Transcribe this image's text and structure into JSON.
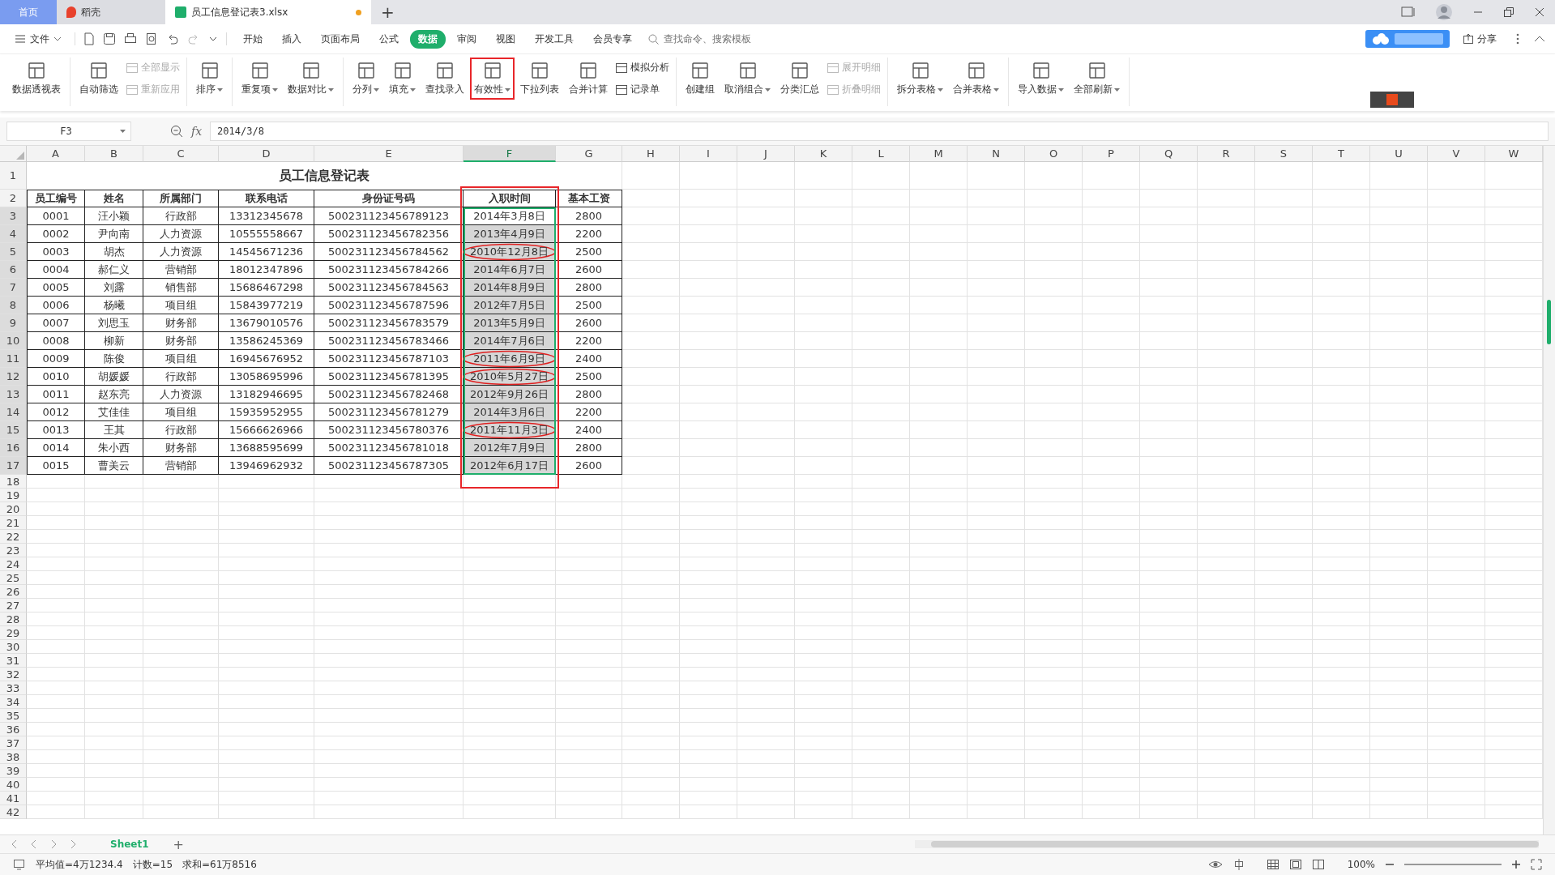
{
  "tabs": [
    {
      "kind": "home",
      "label": "首页",
      "selected": false
    },
    {
      "kind": "docer",
      "label": "稻壳",
      "selected": false
    },
    {
      "kind": "file",
      "label": "员工信息登记表3.xlsx",
      "selected": true,
      "unsaved": true
    }
  ],
  "new_tab": "+",
  "menu": {
    "file": "文件",
    "tabs": [
      {
        "label": "开始",
        "selected": false
      },
      {
        "label": "插入",
        "selected": false
      },
      {
        "label": "页面布局",
        "selected": false
      },
      {
        "label": "公式",
        "selected": false
      },
      {
        "label": "数据",
        "selected": true
      },
      {
        "label": "审阅",
        "selected": false
      },
      {
        "label": "视图",
        "selected": false
      },
      {
        "label": "开发工具",
        "selected": false
      },
      {
        "label": "会员专享",
        "selected": false
      }
    ],
    "search": {
      "placeholder": "查找命令、搜索模板"
    },
    "share": "分享"
  },
  "ribbon": [
    {
      "items": [
        {
          "kind": "large",
          "label": "数据透视表",
          "dropdown": false,
          "highlighted": false
        }
      ]
    },
    {
      "items": [
        {
          "kind": "large",
          "label": "自动筛选",
          "dropdown": false,
          "highlighted": false
        },
        {
          "kind": "stack",
          "items": [
            {
              "label": "全部显示",
              "disabled": true
            },
            {
              "label": "重新应用",
              "disabled": true
            }
          ]
        }
      ]
    },
    {
      "items": [
        {
          "kind": "large",
          "label": "排序",
          "dropdown": true,
          "highlighted": false
        }
      ]
    },
    {
      "items": [
        {
          "kind": "large",
          "label": "重复项",
          "dropdown": true,
          "highlighted": false
        },
        {
          "kind": "large",
          "label": "数据对比",
          "dropdown": true,
          "highlighted": false
        }
      ]
    },
    {
      "items": [
        {
          "kind": "large",
          "label": "分列",
          "dropdown": true,
          "highlighted": false
        },
        {
          "kind": "large",
          "label": "填充",
          "dropdown": true,
          "highlighted": false
        },
        {
          "kind": "large",
          "label": "查找录入",
          "dropdown": false,
          "highlighted": false
        },
        {
          "kind": "large",
          "label": "有效性",
          "dropdown": true,
          "highlighted": true
        },
        {
          "kind": "large",
          "label": "下拉列表",
          "dropdown": false,
          "highlighted": false
        },
        {
          "kind": "large",
          "label": "合并计算",
          "dropdown": false,
          "highlighted": false
        },
        {
          "kind": "stack",
          "items": [
            {
              "label": "模拟分析",
              "disabled": false
            },
            {
              "label": "记录单",
              "disabled": false
            }
          ]
        }
      ]
    },
    {
      "items": [
        {
          "kind": "large",
          "label": "创建组",
          "dropdown": false,
          "highlighted": false
        },
        {
          "kind": "large",
          "label": "取消组合",
          "dropdown": true,
          "highlighted": false
        },
        {
          "kind": "large",
          "label": "分类汇总",
          "dropdown": false,
          "highlighted": false
        },
        {
          "kind": "stack",
          "items": [
            {
              "label": "展开明细",
              "disabled": true
            },
            {
              "label": "折叠明细",
              "disabled": true
            }
          ]
        }
      ]
    },
    {
      "items": [
        {
          "kind": "large",
          "label": "拆分表格",
          "dropdown": true,
          "highlighted": false
        },
        {
          "kind": "large",
          "label": "合并表格",
          "dropdown": true,
          "highlighted": false
        }
      ]
    },
    {
      "items": [
        {
          "kind": "large",
          "label": "导入数据",
          "dropdown": true,
          "highlighted": false
        },
        {
          "kind": "large",
          "label": "全部刷新",
          "dropdown": true,
          "highlighted": false
        }
      ]
    }
  ],
  "formula_bar": {
    "name_box": "F3",
    "fx": "fx",
    "value": "2014/3/8"
  },
  "columns": [
    {
      "label": "A",
      "selected": false
    },
    {
      "label": "B",
      "selected": false
    },
    {
      "label": "C",
      "selected": false
    },
    {
      "label": "D",
      "selected": false
    },
    {
      "label": "E",
      "selected": false
    },
    {
      "label": "F",
      "selected": true
    },
    {
      "label": "G",
      "selected": false
    },
    {
      "label": "H",
      "selected": false
    },
    {
      "label": "I",
      "selected": false
    },
    {
      "label": "J",
      "selected": false
    },
    {
      "label": "K",
      "selected": false
    },
    {
      "label": "L",
      "selected": false
    },
    {
      "label": "M",
      "selected": false
    },
    {
      "label": "N",
      "selected": false
    },
    {
      "label": "O",
      "selected": false
    },
    {
      "label": "P",
      "selected": false
    },
    {
      "label": "Q",
      "selected": false
    },
    {
      "label": "R",
      "selected": false
    },
    {
      "label": "S",
      "selected": false
    },
    {
      "label": "T",
      "selected": false
    },
    {
      "label": "U",
      "selected": false
    },
    {
      "label": "V",
      "selected": false
    },
    {
      "label": "W",
      "selected": false
    }
  ],
  "title_row": {
    "row": "1",
    "text": "员工信息登记表"
  },
  "header_row": {
    "row": "2",
    "cells": [
      "员工编号",
      "姓名",
      "所属部门",
      "联系电话",
      "身份证号码",
      "入职时间",
      "基本工资"
    ]
  },
  "rows": [
    {
      "row": "3",
      "cells": [
        "0001",
        "汪小颖",
        "行政部",
        "13312345678",
        "500231123456789123",
        "2014年3月8日",
        "2800"
      ],
      "selected": true,
      "active": true,
      "circled": false
    },
    {
      "row": "4",
      "cells": [
        "0002",
        "尹向南",
        "人力资源",
        "10555558667",
        "500231123456782356",
        "2013年4月9日",
        "2200"
      ],
      "selected": true,
      "active": false,
      "circled": false
    },
    {
      "row": "5",
      "cells": [
        "0003",
        "胡杰",
        "人力资源",
        "14545671236",
        "500231123456784562",
        "2010年12月8日",
        "2500"
      ],
      "selected": true,
      "active": false,
      "circled": true
    },
    {
      "row": "6",
      "cells": [
        "0004",
        "郝仁义",
        "营销部",
        "18012347896",
        "500231123456784266",
        "2014年6月7日",
        "2600"
      ],
      "selected": true,
      "active": false,
      "circled": false
    },
    {
      "row": "7",
      "cells": [
        "0005",
        "刘露",
        "销售部",
        "15686467298",
        "500231123456784563",
        "2014年8月9日",
        "2800"
      ],
      "selected": true,
      "active": false,
      "circled": false
    },
    {
      "row": "8",
      "cells": [
        "0006",
        "杨曦",
        "项目组",
        "15843977219",
        "500231123456787596",
        "2012年7月5日",
        "2500"
      ],
      "selected": true,
      "active": false,
      "circled": false
    },
    {
      "row": "9",
      "cells": [
        "0007",
        "刘思玉",
        "财务部",
        "13679010576",
        "500231123456783579",
        "2013年5月9日",
        "2600"
      ],
      "selected": true,
      "active": false,
      "circled": false
    },
    {
      "row": "10",
      "cells": [
        "0008",
        "柳新",
        "财务部",
        "13586245369",
        "500231123456783466",
        "2014年7月6日",
        "2200"
      ],
      "selected": true,
      "active": false,
      "circled": false
    },
    {
      "row": "11",
      "cells": [
        "0009",
        "陈俊",
        "项目组",
        "16945676952",
        "500231123456787103",
        "2011年6月9日",
        "2400"
      ],
      "selected": true,
      "active": false,
      "circled": true
    },
    {
      "row": "12",
      "cells": [
        "0010",
        "胡媛媛",
        "行政部",
        "13058695996",
        "500231123456781395",
        "2010年5月27日",
        "2500"
      ],
      "selected": true,
      "active": false,
      "circled": true
    },
    {
      "row": "13",
      "cells": [
        "0011",
        "赵东亮",
        "人力资源",
        "13182946695",
        "500231123456782468",
        "2012年9月26日",
        "2800"
      ],
      "selected": true,
      "active": false,
      "circled": false
    },
    {
      "row": "14",
      "cells": [
        "0012",
        "艾佳佳",
        "项目组",
        "15935952955",
        "500231123456781279",
        "2014年3月6日",
        "2200"
      ],
      "selected": true,
      "active": false,
      "circled": false
    },
    {
      "row": "15",
      "cells": [
        "0013",
        "王其",
        "行政部",
        "15666626966",
        "500231123456780376",
        "2011年11月3日",
        "2400"
      ],
      "selected": true,
      "active": false,
      "circled": true
    },
    {
      "row": "16",
      "cells": [
        "0014",
        "朱小西",
        "财务部",
        "13688595699",
        "500231123456781018",
        "2012年7月9日",
        "2800"
      ],
      "selected": true,
      "active": false,
      "circled": false
    },
    {
      "row": "17",
      "cells": [
        "0015",
        "曹美云",
        "营销部",
        "13946962932",
        "500231123456787305",
        "2012年6月17日",
        "2600"
      ],
      "selected": true,
      "active": false,
      "circled": false
    }
  ],
  "empty_rows": [
    "18",
    "19",
    "20",
    "21",
    "22",
    "23",
    "24",
    "25",
    "26",
    "27",
    "28",
    "29",
    "30",
    "31",
    "32",
    "33",
    "34",
    "35",
    "36",
    "37",
    "38",
    "39",
    "40",
    "41",
    "42"
  ],
  "sheets": [
    {
      "label": "Sheet1",
      "selected": true
    }
  ],
  "add_sheet": "+",
  "status_bar": {
    "stats": [
      "平均值=4万1234.4",
      "计数=15",
      "求和=61万8516"
    ],
    "zoom": "100%",
    "zoom_level": {
      "level": 0.5
    }
  }
}
